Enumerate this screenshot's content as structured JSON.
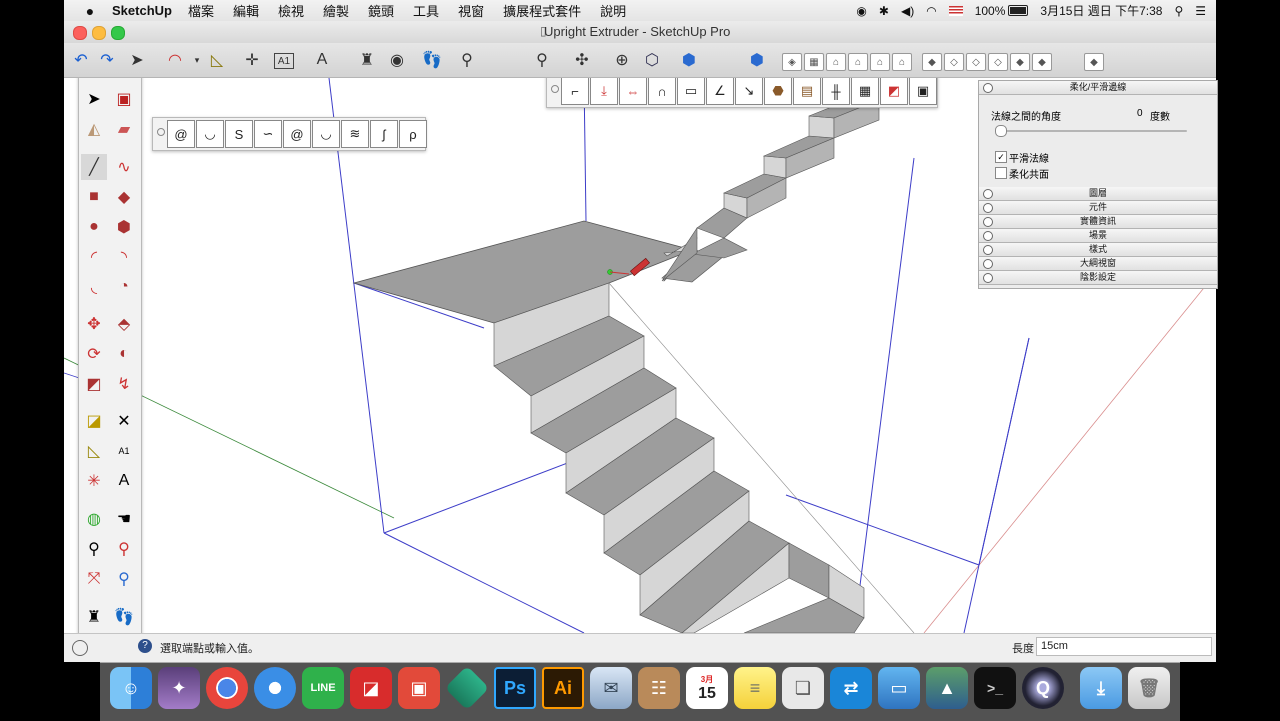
{
  "menubar": {
    "apple": "",
    "app_name": "SketchUp",
    "items": [
      "檔案",
      "編輯",
      "檢視",
      "繪製",
      "鏡頭",
      "工具",
      "視窗",
      "擴展程式套件",
      "說明"
    ],
    "battery": "100%",
    "datetime": "3月15日 週日 下午7:38"
  },
  "window": {
    "title": "Upright Extruder - SketchUp Pro"
  },
  "large_tool_set": {
    "text_tool_label": "A1"
  },
  "tray": {
    "open_panel": {
      "title": "柔化/平滑邊線",
      "angle_label": "法線之間的角度",
      "angle_value": "0",
      "angle_unit": "度數",
      "checkbox_smooth_label": "平滑法線",
      "checkbox_smooth_checked": true,
      "checkbox_soften_label": "柔化共面",
      "checkbox_soften_checked": false,
      "slider_value_fraction": 0.0
    },
    "panels": [
      "圖層",
      "元件",
      "實體資訊",
      "場景",
      "樣式",
      "大綱視窗",
      "陰影設定"
    ]
  },
  "status": {
    "hint": "選取端點或輸入值。",
    "measure_label": "長度",
    "measure_value": "15cm"
  },
  "dock": {
    "calendar_month": "3月",
    "calendar_day": "15",
    "ps_label": "Ps",
    "ai_label": "Ai",
    "line_label": "LINE"
  },
  "colors": {
    "stair_top": "#9d9d9d",
    "stair_face": "#d6d6d6",
    "axis_blue": "#3d3dc8",
    "axis_red": "#c84a4a",
    "axis_green": "#3c8a3c"
  }
}
